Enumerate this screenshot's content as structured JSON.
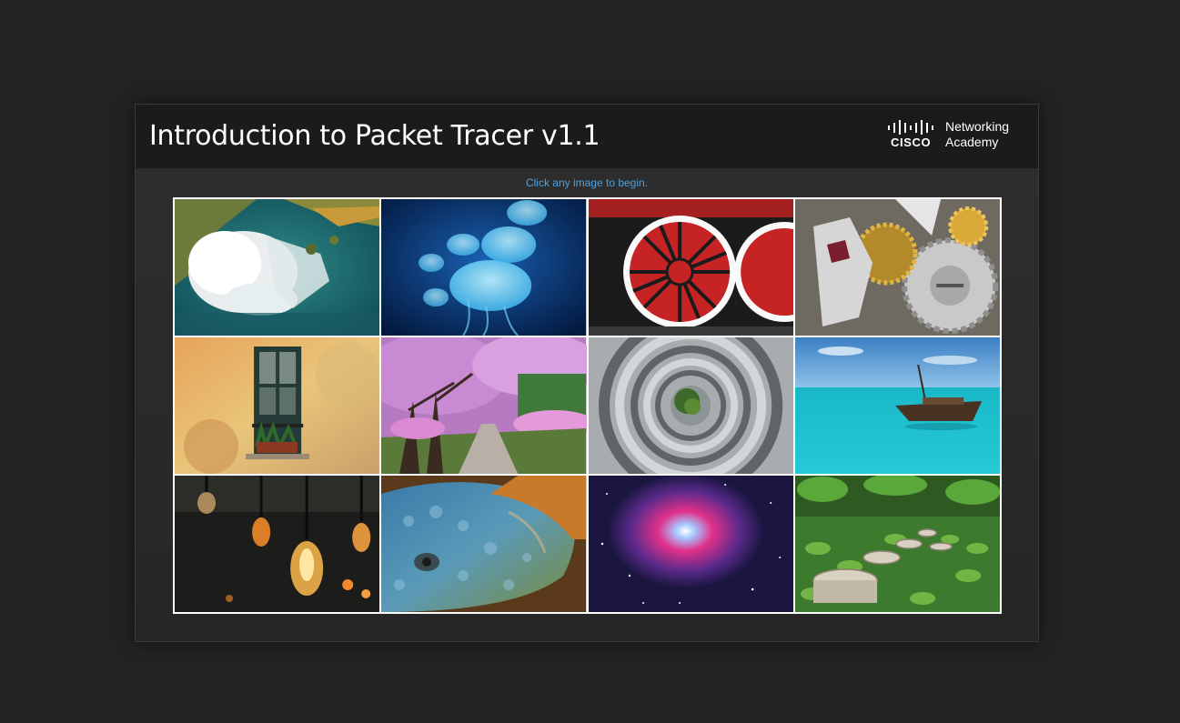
{
  "module": {
    "title": "Introduction to Packet Tracer v1.1",
    "instruction": "Click any image to begin."
  },
  "brand": {
    "logo_icon": "cisco-bars-icon",
    "wordmark": "CISCO",
    "line1": "Networking",
    "line2": "Academy"
  },
  "gallery": {
    "images": [
      {
        "subject": "waterfall-aerial",
        "icon": "waterfall-image"
      },
      {
        "subject": "jellyfish",
        "icon": "jellyfish-image"
      },
      {
        "subject": "locomotive-wheels",
        "icon": "train-wheel-image"
      },
      {
        "subject": "watch-gears",
        "icon": "gears-image"
      },
      {
        "subject": "old-window",
        "icon": "window-image"
      },
      {
        "subject": "cherry-blossom-path",
        "icon": "blossom-image"
      },
      {
        "subject": "spiral-staircase",
        "icon": "staircase-image"
      },
      {
        "subject": "boat-turquoise-sea",
        "icon": "boat-image"
      },
      {
        "subject": "hanging-light-bulbs",
        "icon": "light-bulbs-image"
      },
      {
        "subject": "iguana-closeup",
        "icon": "iguana-image"
      },
      {
        "subject": "nebula",
        "icon": "nebula-image"
      },
      {
        "subject": "stepping-stones-lily-pads",
        "icon": "stepping-stones-image"
      }
    ]
  },
  "colors": {
    "page_bg": "#232323",
    "panel_bg": "#2a2a2a",
    "header_bg": "#1b1b1b",
    "title_text": "#ffffff",
    "instruction_text": "#4aa3e6",
    "grid_border": "#ffffff"
  }
}
